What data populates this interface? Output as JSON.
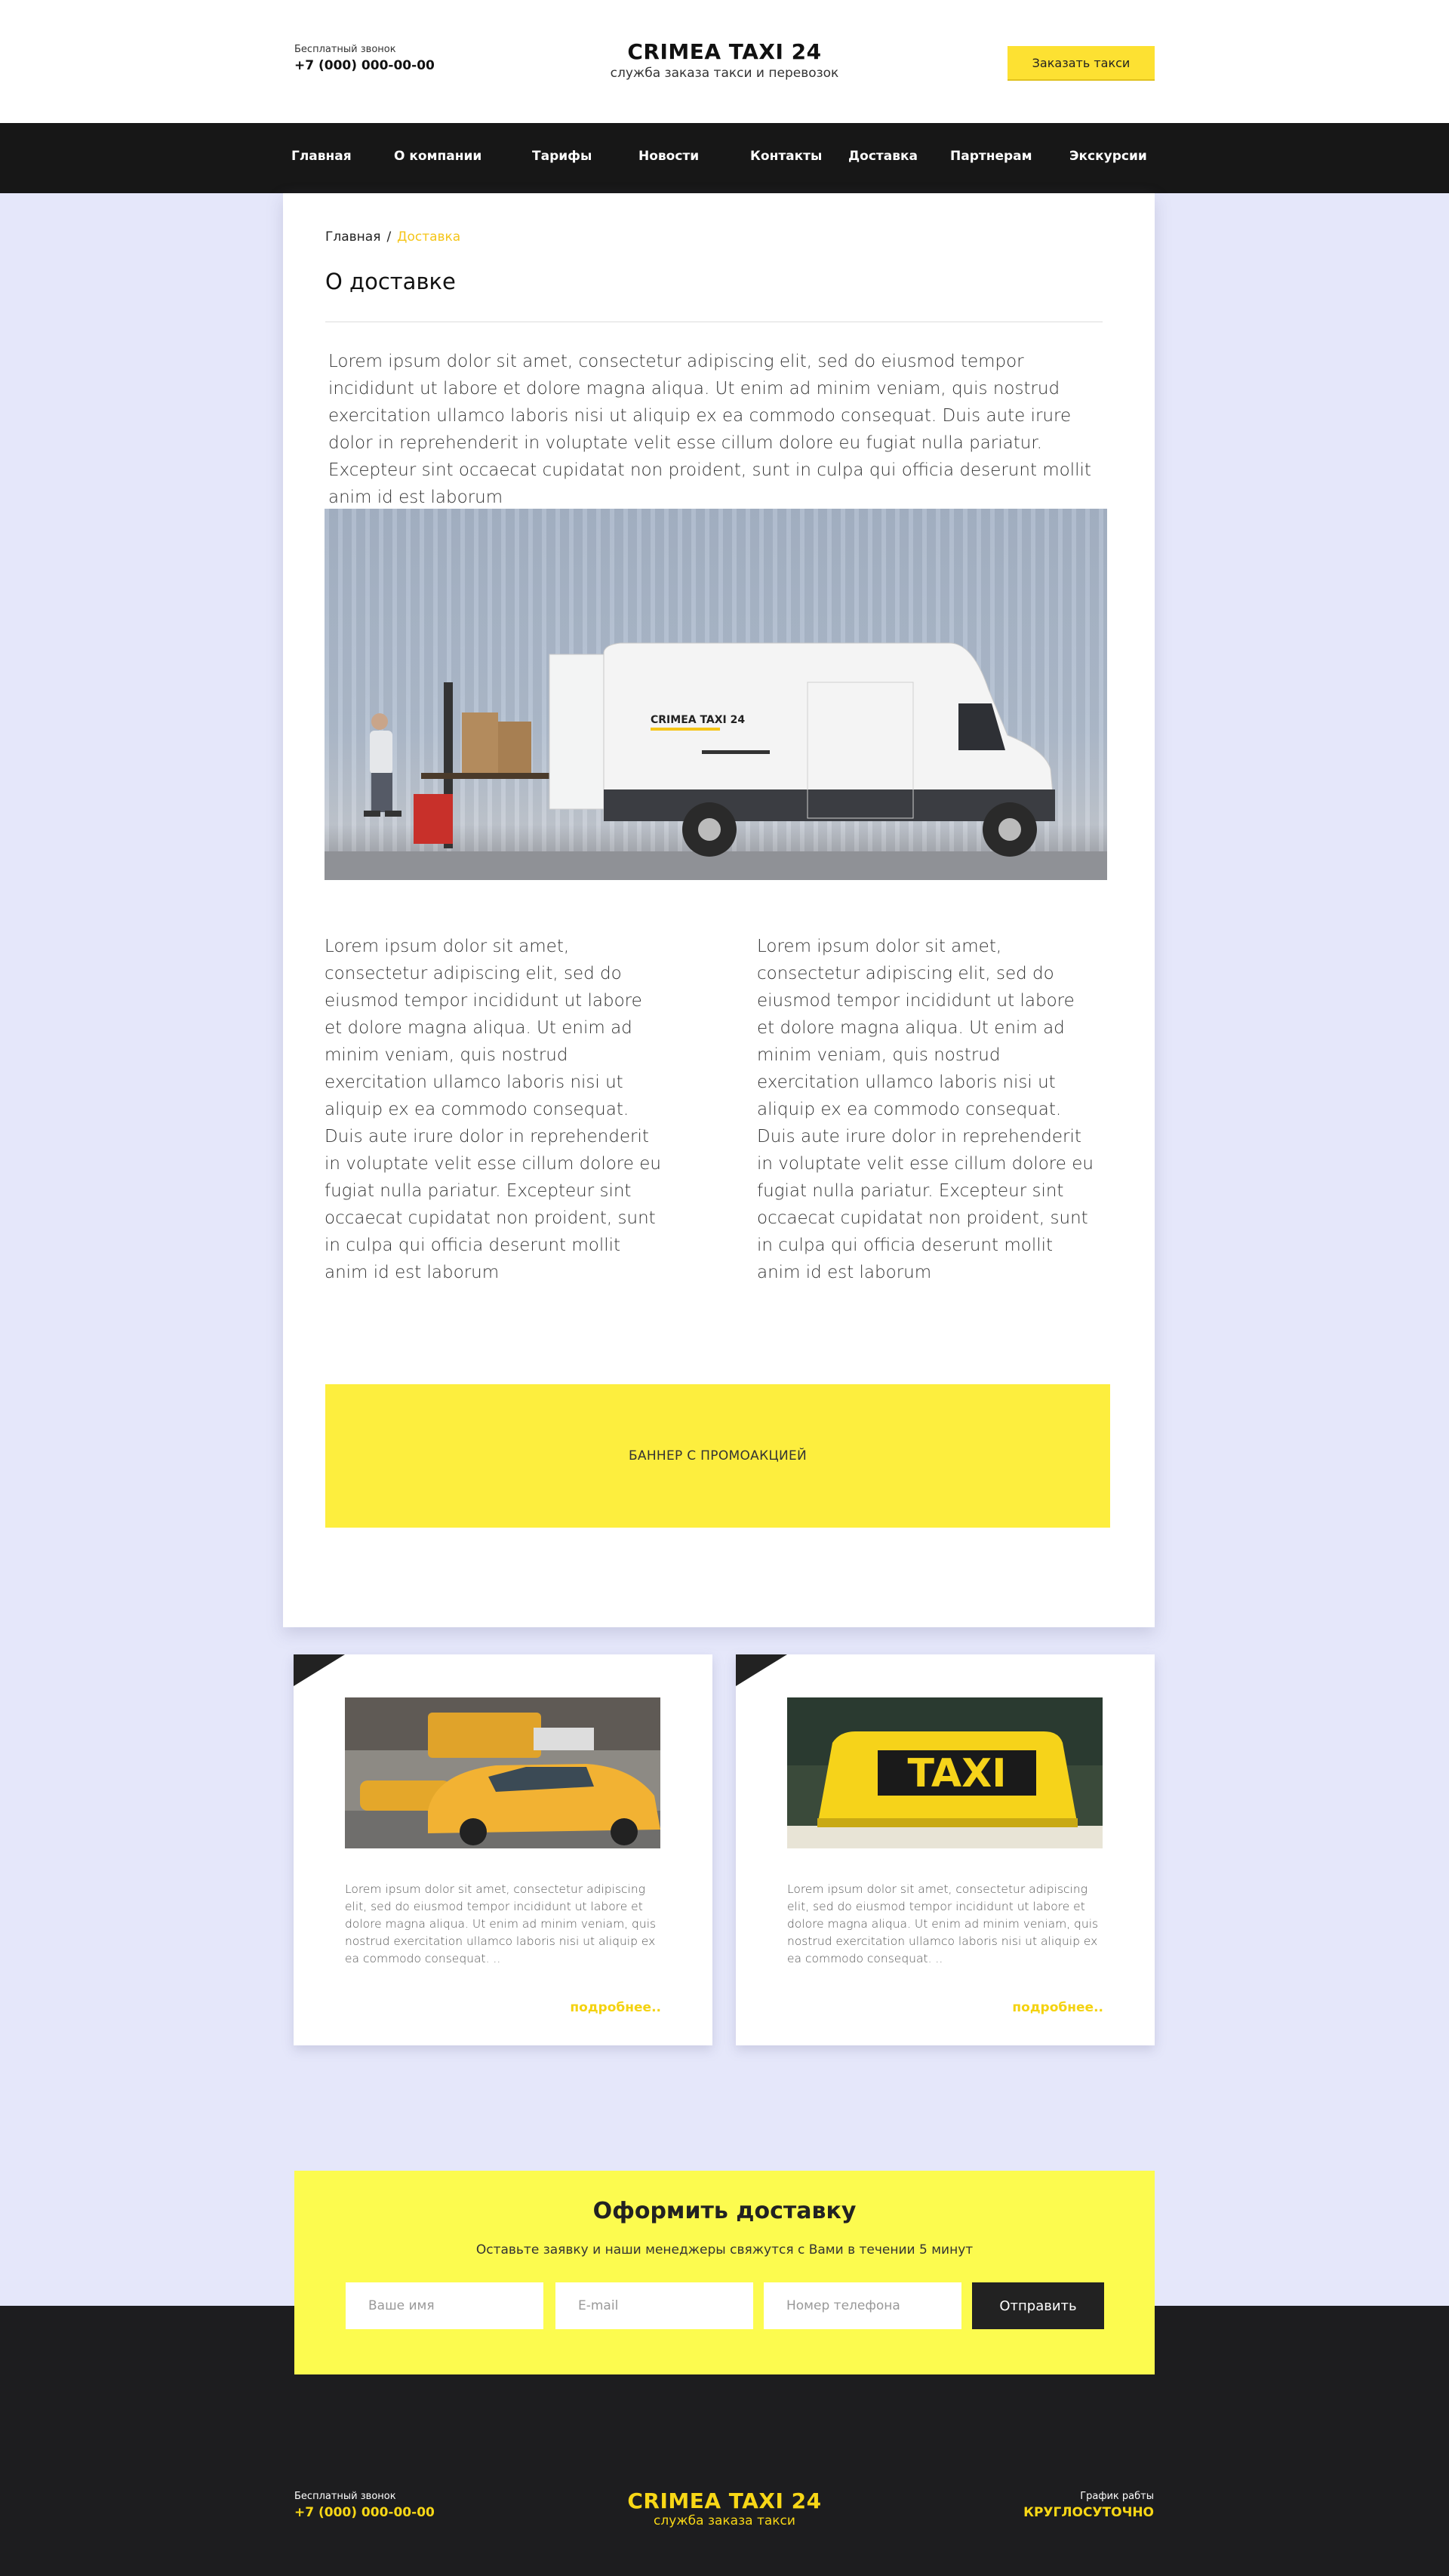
{
  "header": {
    "phone_label": "Бесплатный звонок",
    "phone": "+7 (000) 000-00-00",
    "logo_title": "CRIMEA TAXI 24",
    "logo_sub": "служба заказа такси и перевозок",
    "order_button": "Заказать такси"
  },
  "nav": [
    {
      "label": "Главная"
    },
    {
      "label": "О компании"
    },
    {
      "label": "Тарифы"
    },
    {
      "label": "Новости"
    },
    {
      "label": "Контакты"
    },
    {
      "label": "Доставка"
    },
    {
      "label": "Партнерам"
    },
    {
      "label": "Экскурсии"
    }
  ],
  "breadcrumb": {
    "home": "Главная",
    "separator": "/",
    "current": "Доставка"
  },
  "page_title": "О доставке",
  "intro_text": "Lorem ipsum dolor sit amet, consectetur adipiscing elit, sed do eiusmod tempor incididunt ut labore et dolore magna aliqua. Ut enim ad minim veniam, quis nostrud exercitation ullamco laboris nisi ut aliquip ex ea commodo consequat. Duis aute irure dolor in reprehenderit in voluptate velit esse cillum dolore eu fugiat nulla pariatur. Excepteur sint occaecat cupidatat non proident, sunt in culpa qui officia deserunt mollit anim id est laborum",
  "van_logo_text": "CRIMEA TAXI 24",
  "columns": [
    "Lorem ipsum dolor sit amet, consectetur adipiscing elit, sed do eiusmod tempor incididunt ut labore et dolore magna aliqua. Ut enim ad minim veniam, quis nostrud exercitation ullamco laboris nisi ut aliquip ex ea commodo consequat. Duis aute irure dolor in reprehenderit in voluptate velit esse cillum dolore eu fugiat nulla pariatur. Excepteur sint occaecat cupidatat non proident, sunt in culpa qui officia deserunt mollit anim id est laborum",
    "Lorem ipsum dolor sit amet, consectetur adipiscing elit, sed do eiusmod tempor incididunt ut labore et dolore magna aliqua. Ut enim ad minim veniam, quis nostrud exercitation ullamco laboris nisi ut aliquip ex ea commodo consequat. Duis aute irure dolor in reprehenderit in voluptate velit esse cillum dolore eu fugiat nulla pariatur. Excepteur sint occaecat cupidatat non proident, sunt in culpa qui officia deserunt mollit anim id est laborum"
  ],
  "promo_banner": "БАННЕР С ПРОМОАКЦИЕЙ",
  "cards": [
    {
      "text": "Lorem ipsum dolor sit amet, consectetur adipiscing elit, sed do eiusmod tempor incididunt ut labore et dolore magna aliqua. Ut enim ad minim veniam, quis nostrud exercitation ullamco laboris nisi ut aliquip ex ea commodo consequat. ..",
      "more": "подробнее.."
    },
    {
      "text": "Lorem ipsum dolor sit amet, consectetur adipiscing elit, sed do eiusmod tempor incididunt ut labore et dolore magna aliqua. Ut enim ad minim veniam, quis nostrud exercitation ullamco laboris nisi ut aliquip ex ea commodo consequat. ..",
      "more": "подробнее..",
      "sign_text": "TAXI"
    }
  ],
  "order_form": {
    "title": "Оформить доставку",
    "subtitle": "Оставьте заявку и наши менеджеры свяжутся с Вами в течении 5 минут",
    "name_placeholder": "Ваше имя",
    "email_placeholder": "E-mail",
    "phone_placeholder": "Номер телефона",
    "submit": "Отправить"
  },
  "footer": {
    "phone_label": "Бесплатный звонок",
    "phone": "+7 (000) 000-00-00",
    "logo_title": "CRIMEA TAXI 24",
    "logo_sub": "служба заказа такси",
    "schedule_label": "График рабты",
    "schedule_value": "КРУГЛОСУТОЧНО"
  },
  "colors": {
    "accent_yellow": "#fde132",
    "dark": "#171717",
    "page_bg": "#e5e7fa"
  }
}
